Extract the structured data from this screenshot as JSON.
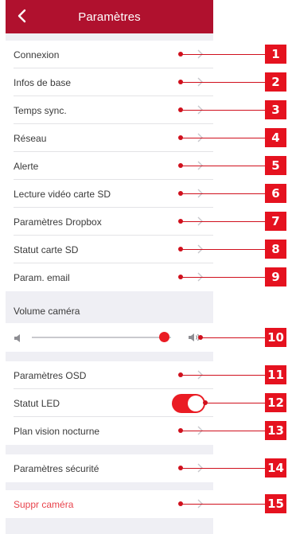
{
  "header": {
    "title": "Paramètres"
  },
  "menu_group_1": [
    {
      "id": "connexion",
      "label": "Connexion"
    },
    {
      "id": "infos",
      "label": "Infos de base"
    },
    {
      "id": "temps",
      "label": "Temps sync."
    },
    {
      "id": "reseau",
      "label": "Réseau"
    },
    {
      "id": "alerte",
      "label": "Alerte"
    },
    {
      "id": "lecture",
      "label": "Lecture vidéo carte SD"
    },
    {
      "id": "dropbox",
      "label": "Paramètres Dropbox"
    },
    {
      "id": "statut-sd",
      "label": "Statut carte SD"
    },
    {
      "id": "email",
      "label": "Param. email"
    }
  ],
  "volume": {
    "label": "Volume caméra",
    "level": 0.95
  },
  "menu_group_2": {
    "osd": "Paramètres OSD",
    "led": "Statut LED",
    "led_on": true,
    "night": "Plan vision nocturne"
  },
  "security": "Paramètres sécurité",
  "delete": "Suppr caméra",
  "callouts": [
    "1",
    "2",
    "3",
    "4",
    "5",
    "6",
    "7",
    "8",
    "9",
    "10",
    "11",
    "12",
    "13",
    "14",
    "15"
  ],
  "colors": {
    "header": "#b0112e",
    "accent": "#ea1c24",
    "callout": "#e5121f",
    "danger_text": "#e8434c"
  }
}
